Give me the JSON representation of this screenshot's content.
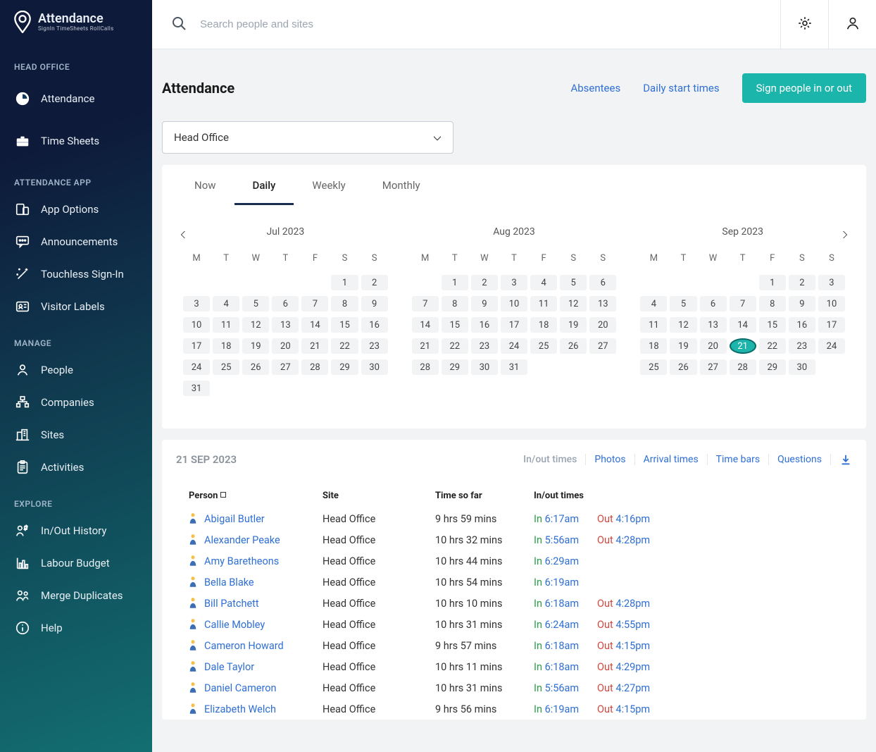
{
  "brand": {
    "title": "Attendance",
    "sub": "SignIn  TimeSheets  RollCalls"
  },
  "search": {
    "placeholder": "Search people and sites"
  },
  "sidebar": {
    "section1_label": "HEAD OFFICE",
    "section1_items": [
      {
        "label": "Attendance"
      },
      {
        "label": "Time Sheets"
      }
    ],
    "section2_label": "ATTENDANCE APP",
    "section2_items": [
      {
        "label": "App Options"
      },
      {
        "label": "Announcements"
      },
      {
        "label": "Touchless Sign-In"
      },
      {
        "label": "Visitor Labels"
      }
    ],
    "section3_label": "MANAGE",
    "section3_items": [
      {
        "label": "People"
      },
      {
        "label": "Companies"
      },
      {
        "label": "Sites"
      },
      {
        "label": "Activities"
      }
    ],
    "section4_label": "EXPLORE",
    "section4_items": [
      {
        "label": "In/Out History"
      },
      {
        "label": "Labour Budget"
      },
      {
        "label": "Merge Duplicates"
      },
      {
        "label": "Help"
      }
    ]
  },
  "page": {
    "title": "Attendance",
    "absentees": "Absentees",
    "dailyStart": "Daily start times",
    "signBtn": "Sign people in or out",
    "siteSelected": "Head Office"
  },
  "tabs": {
    "now": "Now",
    "daily": "Daily",
    "weekly": "Weekly",
    "monthly": "Monthly",
    "active": "daily"
  },
  "calendars": {
    "dows": [
      "M",
      "T",
      "W",
      "T",
      "F",
      "S",
      "S"
    ],
    "months": [
      {
        "title": "Jul 2023",
        "startOffset": 5,
        "days": 31,
        "today": null
      },
      {
        "title": "Aug 2023",
        "startOffset": 1,
        "days": 31,
        "today": null
      },
      {
        "title": "Sep 2023",
        "startOffset": 4,
        "days": 30,
        "today": 21
      }
    ]
  },
  "records": {
    "dateLabel": "21 SEP 2023",
    "views": {
      "inout": "In/out times",
      "photos": "Photos",
      "arrival": "Arrival times",
      "timebars": "Time bars",
      "questions": "Questions"
    },
    "columns": {
      "person": "Person",
      "site": "Site",
      "time": "Time so far",
      "inout": "In/out times",
      "inPrefix": "In",
      "outPrefix": "Out"
    },
    "rows": [
      {
        "person": "Abigail Butler",
        "site": "Head Office",
        "time": "9 hrs 59 mins",
        "in": "6:17am",
        "out": "4:16pm"
      },
      {
        "person": "Alexander Peake",
        "site": "Head Office",
        "time": "10 hrs 32 mins",
        "in": "5:56am",
        "out": "4:28pm"
      },
      {
        "person": "Amy Baretheons",
        "site": "Head Office",
        "time": "10 hrs 44 mins",
        "in": "6:29am",
        "out": ""
      },
      {
        "person": "Bella Blake",
        "site": "Head Office",
        "time": "10 hrs 54 mins",
        "in": "6:19am",
        "out": ""
      },
      {
        "person": "Bill Patchett",
        "site": "Head Office",
        "time": "10 hrs 10 mins",
        "in": "6:18am",
        "out": "4:28pm"
      },
      {
        "person": "Callie Mobley",
        "site": "Head Office",
        "time": "10 hrs 31 mins",
        "in": "6:24am",
        "out": "4:55pm"
      },
      {
        "person": "Cameron Howard",
        "site": "Head Office",
        "time": "9 hrs 57 mins",
        "in": "6:18am",
        "out": "4:15pm"
      },
      {
        "person": "Dale Taylor",
        "site": "Head Office",
        "time": "10 hrs 11 mins",
        "in": "6:18am",
        "out": "4:29pm"
      },
      {
        "person": "Daniel Cameron",
        "site": "Head Office",
        "time": "10 hrs 31 mins",
        "in": "5:56am",
        "out": "4:27pm"
      },
      {
        "person": "Elizabeth Welch",
        "site": "Head Office",
        "time": "9 hrs 56 mins",
        "in": "6:19am",
        "out": "4:15pm"
      }
    ]
  }
}
